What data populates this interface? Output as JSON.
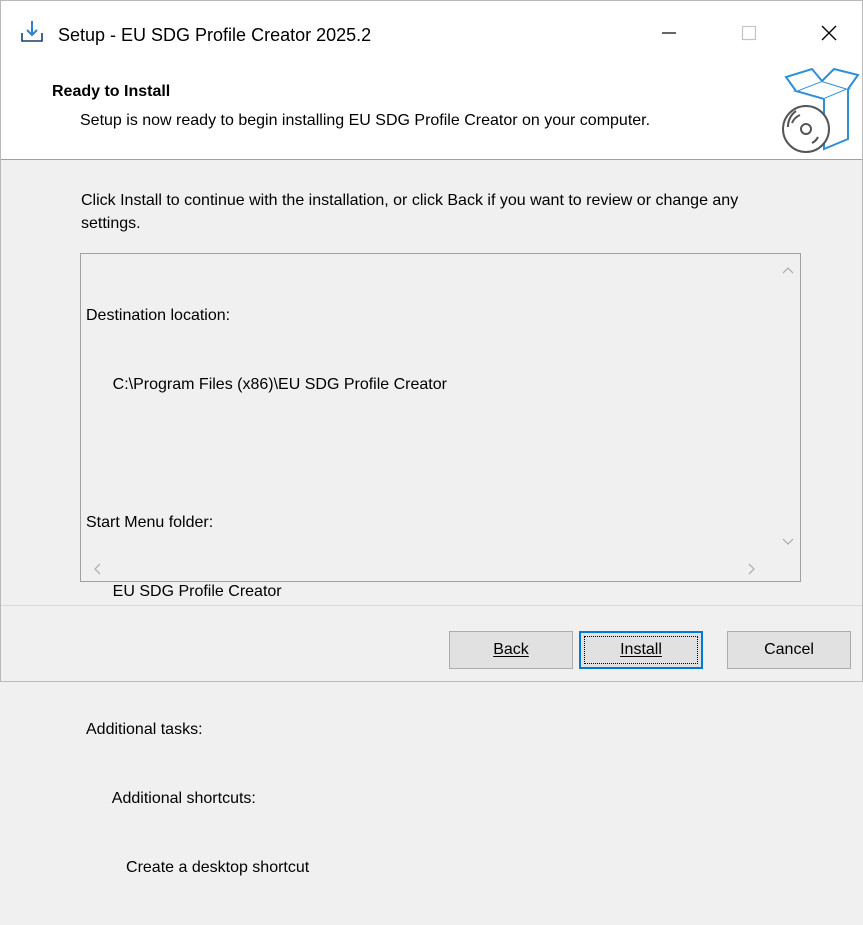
{
  "window": {
    "title": "Setup - EU SDG Profile Creator 2025.2"
  },
  "header": {
    "title": "Ready to Install",
    "subtitle": "Setup is now ready to begin installing EU SDG Profile Creator on your computer."
  },
  "main": {
    "intro": "Click Install to continue with the installation, or click Back if you want to review or change any settings.",
    "memo_lines": [
      "Destination location:",
      "      C:\\Program Files (x86)\\EU SDG Profile Creator",
      "",
      "Start Menu folder:",
      "      EU SDG Profile Creator",
      "",
      "Additional tasks:",
      "      Additional shortcuts:",
      "         Create a desktop shortcut"
    ]
  },
  "buttons": {
    "back": "Back",
    "install": "Install",
    "cancel": "Cancel"
  },
  "colors": {
    "accent": "#0078d7",
    "button_face": "#e1e1e1",
    "window_bg": "#f0f0f0"
  },
  "icons": {
    "app": "download-setup-icon",
    "header": "box-with-disc-icon"
  }
}
